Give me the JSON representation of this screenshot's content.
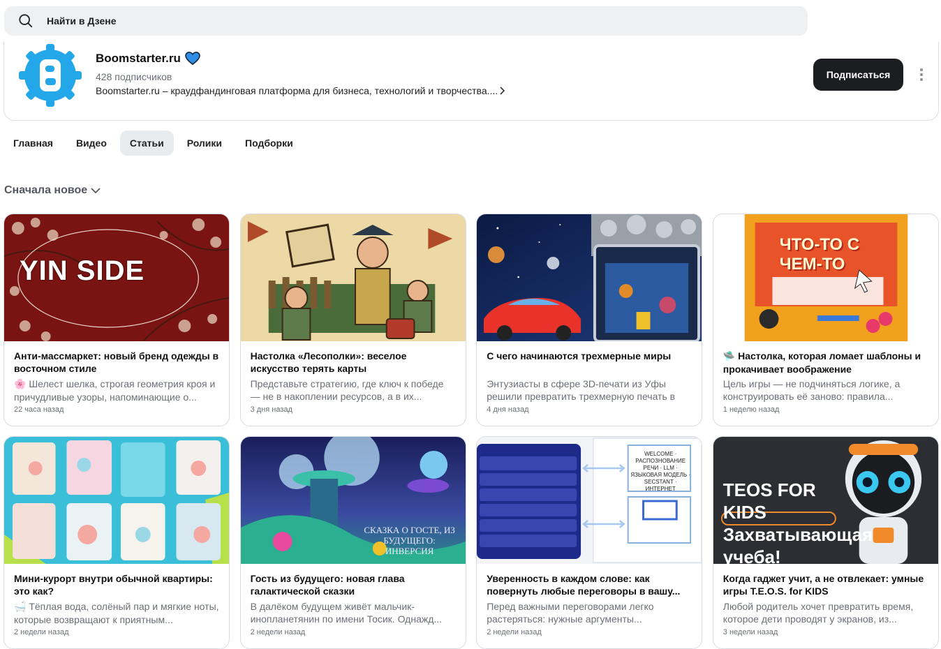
{
  "search": {
    "placeholder": "Найти в Дзене"
  },
  "channel": {
    "name": "Boomstarter.ru",
    "subscribers": "428 подписчиков",
    "description": "Boomstarter.ru – краудфандинговая платформа для бизнеса, технологий и творчества....",
    "subscribe_label": "Подписаться",
    "logo_letter": "B",
    "brand_color": "#23a7e8"
  },
  "tabs": [
    {
      "label": "Главная",
      "active": false
    },
    {
      "label": "Видео",
      "active": false
    },
    {
      "label": "Статьи",
      "active": true
    },
    {
      "label": "Ролики",
      "active": false
    },
    {
      "label": "Подборки",
      "active": false
    }
  ],
  "sort": {
    "label": "Сначала новое"
  },
  "cards": [
    {
      "title": "Анти-массмаркет: новый бренд одежды в восточном стиле",
      "emoji": "🌸",
      "snippet": "Шелест шелка, строгая геометрия кроя и причудливые узоры, напоминающие о...",
      "time": "22 часа назад",
      "image_text": "YIN SIDE"
    },
    {
      "title": "Настолка «Лесополки»: веселое искусство терять карты",
      "emoji": "",
      "snippet": "Представьте стратегию, где ключ к победе — не в накоплении ресурсов, а в их...",
      "time": "3 дня назад",
      "image_text": ""
    },
    {
      "title": "С чего начинаются трехмерные миры",
      "emoji": "",
      "snippet": "Энтузиасты в сфере 3D-печати из Уфы решили превратить трехмерную печать в инструмент, который поможет любому...",
      "time": "4 дня назад",
      "image_text": ""
    },
    {
      "title": "Настолка, которая ломает шаблоны и прокачивает воображение",
      "emoji": "🛸",
      "snippet": "Цель игры — не подчиняться логике, а конструировать её заново: правила...",
      "time": "1 неделю назад",
      "image_text": "ЧТО-ТО С ЧЕМ-ТО"
    },
    {
      "title": "Мини-курорт внутри обычной квартиры: это как?",
      "emoji": "🛁",
      "snippet": "Тёплая вода, солёный пар и мягкие ноты, которые возвращают к приятным...",
      "time": "2 недели назад",
      "image_text": ""
    },
    {
      "title": "Гость из будущего: новая глава галактической сказки",
      "emoji": "",
      "snippet": "В далёком будущем живёт мальчик-инопланетянин по имени Тосик. Однажд...",
      "time": "2 недели назад",
      "image_text": "СКАЗКА О ГОСТЕ, ИЗ БУДУЩЕГО: ИНВЕРСИЯ"
    },
    {
      "title": "Уверенность в каждом слове: как повернуть любые переговоры в вашу...",
      "emoji": "",
      "snippet": "Перед важными переговорами легко растеряться: нужные аргументы...",
      "time": "2 недели назад",
      "image_text": "WELCOME · РАСПОЗНОВАНИЕ РЕЧИ · LLM · ЯЗЫКОВАЯ МОДЕЛЬ · SECSTANT · ИНТЕРНЕТ"
    },
    {
      "title": "Когда гаджет учит, а не отвлекает: умные игры T.E.O.S. for KIDS",
      "emoji": "",
      "snippet": "Любой родитель хочет превратить время, которое дети проводят у экранов, из...",
      "time": "3 недели назад",
      "image_text": "TEOS FOR KIDS Захватывающая учеба!"
    }
  ]
}
